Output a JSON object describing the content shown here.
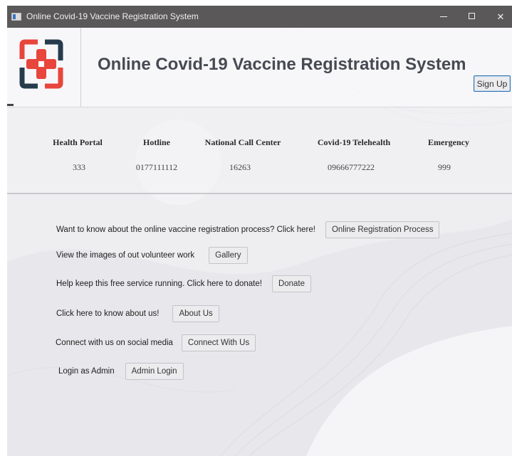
{
  "window": {
    "title": "Online Covid-19 Vaccine Registration System",
    "controls": {
      "minimize": "",
      "maximize": "",
      "close": "✕"
    }
  },
  "header": {
    "title": "Online Covid-19 Vaccine Registration System",
    "logo_icon": "medical-cross-logo-icon",
    "signup_label": "Sign Up"
  },
  "contacts": [
    {
      "label": "Health Portal",
      "value": "333"
    },
    {
      "label": "Hotline",
      "value": "0177111112"
    },
    {
      "label": "National Call Center",
      "value": "16263"
    },
    {
      "label": "Covid-19 Telehealth",
      "value": "09666777222"
    },
    {
      "label": "Emergency",
      "value": "999"
    }
  ],
  "actions": [
    {
      "text": "Want to know about the online vaccine registration process? Click here!",
      "button": "Online Registration Process"
    },
    {
      "text": "View the images of out volunteer work",
      "button": "Gallery"
    },
    {
      "text": "Help keep this free service running. Click here to donate!",
      "button": "Donate"
    },
    {
      "text": "Click here to know about us!",
      "button": "About Us"
    },
    {
      "text": "Connect with us on social media",
      "button": "Connect With Us"
    },
    {
      "text": "Login as Admin",
      "button": "Admin Login"
    }
  ],
  "colors": {
    "titlebar": "#5a5858",
    "logo_red": "#e8453c",
    "logo_dark": "#263c4c",
    "accent_border": "#2d6fb3"
  }
}
